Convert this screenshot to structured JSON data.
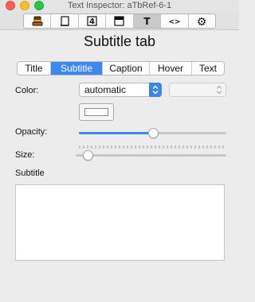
{
  "window": {
    "title": "Text Inspector: aTbRef-6-1"
  },
  "toolbar": {
    "items": [
      {
        "icon": "hat-icon",
        "active": false
      },
      {
        "icon": "note-icon",
        "active": false
      },
      {
        "icon": "four-icon",
        "glyph": "4",
        "active": false
      },
      {
        "icon": "window-icon",
        "active": false
      },
      {
        "icon": "text-icon",
        "glyph": "T",
        "active": true
      },
      {
        "icon": "code-icon",
        "glyph": "<>",
        "active": false
      },
      {
        "icon": "gear-icon",
        "glyph": "⚙",
        "active": false
      }
    ]
  },
  "page": {
    "title": "Subtitle tab"
  },
  "tabs": {
    "items": [
      {
        "label": "Title",
        "selected": false
      },
      {
        "label": "Subtitle",
        "selected": true
      },
      {
        "label": "Caption",
        "selected": false
      },
      {
        "label": "Hover",
        "selected": false
      },
      {
        "label": "Text",
        "selected": false
      }
    ]
  },
  "form": {
    "color_label": "Color:",
    "color_value": "automatic",
    "secondary_value": "",
    "opacity_label": "Opacity:",
    "opacity_fraction": 0.5,
    "size_label": "Size:",
    "size_fraction": 0.08,
    "subtitle_label": "Subtitle",
    "subtitle_text": ""
  },
  "colors": {
    "accent": "#3b88ee",
    "close": "#fc5f57",
    "minimize": "#fdbc2e",
    "zoom": "#28c840"
  }
}
